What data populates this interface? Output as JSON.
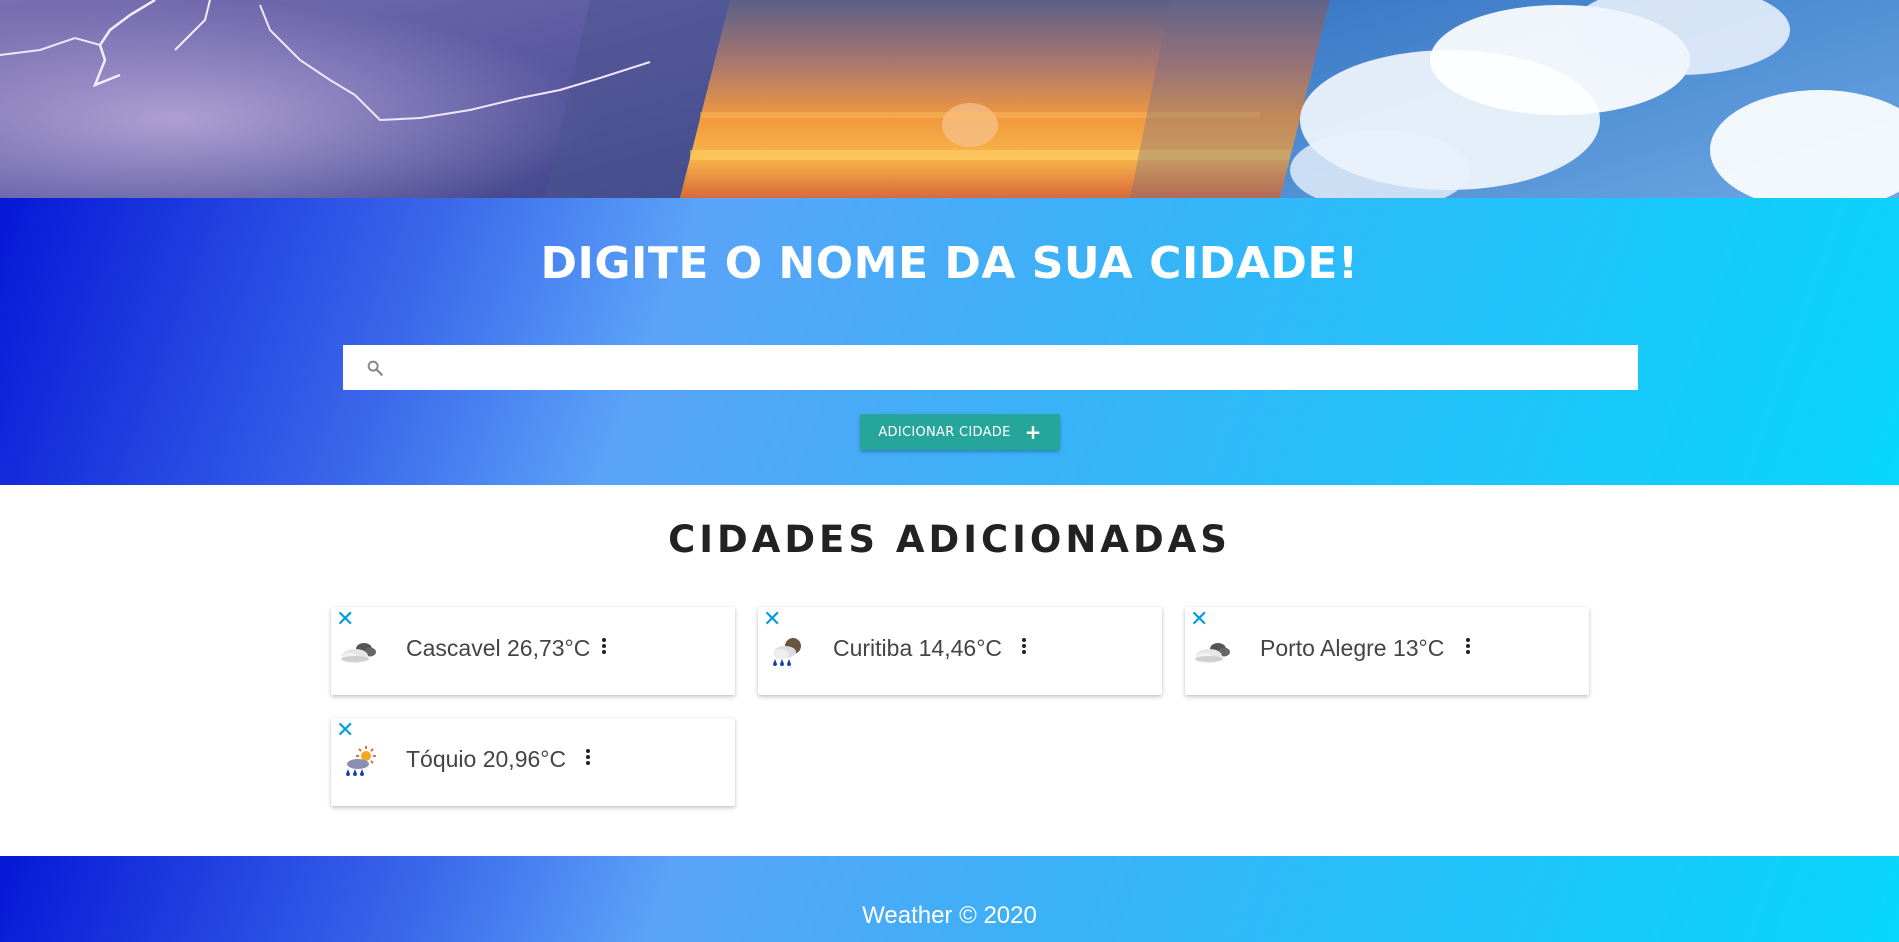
{
  "hero": {
    "title": "DIGITE O NOME DA SUA CIDADE!",
    "search": {
      "value": "",
      "placeholder": "",
      "icon": "search-icon"
    },
    "add_button": {
      "label": "ADICIONAR CIDADE",
      "icon": "plus-icon"
    }
  },
  "cities": {
    "title": "CIDADES ADICIONADAS",
    "items": [
      {
        "label": "Cascavel 26,73°C",
        "icon": "cloudy-icon"
      },
      {
        "label": "Curitiba 14,46°C",
        "icon": "rain-night-icon"
      },
      {
        "label": "Porto Alegre 13°C",
        "icon": "cloudy-icon"
      },
      {
        "label": "Tóquio 20,96°C",
        "icon": "rain-sun-icon"
      }
    ],
    "close_glyph": "✕"
  },
  "footer": {
    "text": "Weather © 2020"
  },
  "colors": {
    "accent_button": "#26a69a",
    "gradient_start": "#0518d6",
    "gradient_end": "#07d6fd",
    "close_icon": "#039be5"
  }
}
